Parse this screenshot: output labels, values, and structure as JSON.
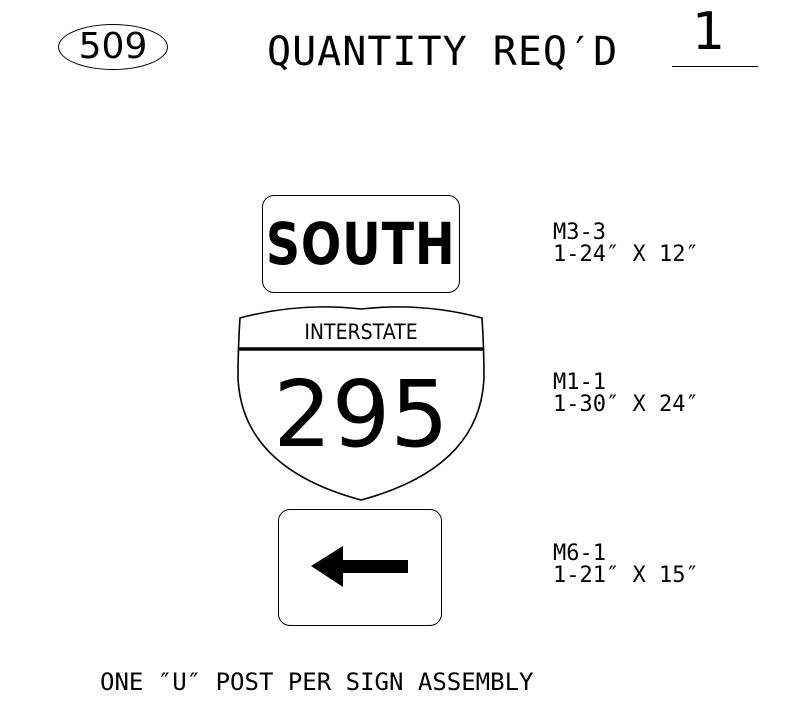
{
  "header": {
    "sheet_number": "509",
    "quantity_label": "QUANTITY REQ′D",
    "quantity_value": "1"
  },
  "signs": [
    {
      "id": "cardinal-direction",
      "legend": "SOUTH",
      "code": "M3-3",
      "size": "1-24″ X 12″"
    },
    {
      "id": "interstate-shield",
      "banner": "INTERSTATE",
      "route": "295",
      "code": "M1-1",
      "size": "1-30″ X 24″"
    },
    {
      "id": "directional-arrow",
      "arrow_direction": "left",
      "code": "M6-1",
      "size": "1-21″ X 15″"
    }
  ],
  "footer": {
    "note": "ONE ″U″ POST PER SIGN ASSEMBLY"
  }
}
